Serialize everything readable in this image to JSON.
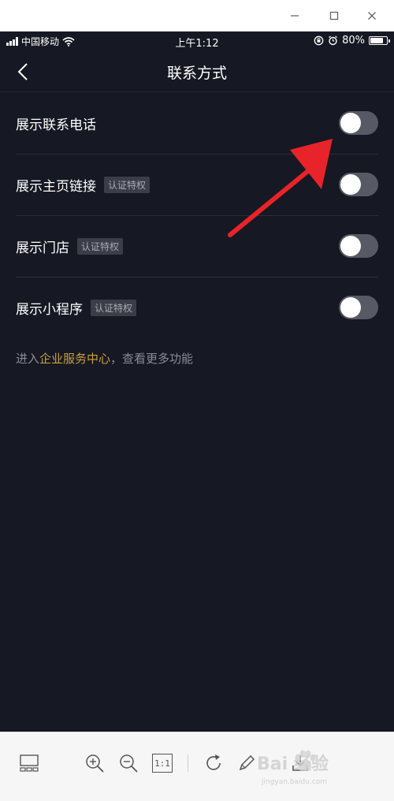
{
  "window": {
    "controls": [
      "minimize-icon",
      "maximize-icon",
      "close-icon"
    ]
  },
  "status_bar": {
    "carrier": "中国移动",
    "time": "上午1:12",
    "battery": "80%",
    "battery_level": 0.8
  },
  "nav": {
    "title": "联系方式",
    "back_icon": "chevron-left-icon"
  },
  "settings": [
    {
      "label": "展示联系电话",
      "badge": "",
      "enabled": false
    },
    {
      "label": "展示主页链接",
      "badge": "认证特权",
      "enabled": false
    },
    {
      "label": "展示门店",
      "badge": "认证特权",
      "enabled": false
    },
    {
      "label": "展示小程序",
      "badge": "认证特权",
      "enabled": false
    }
  ],
  "footer": {
    "prefix": "进入",
    "link": "企业服务中心",
    "suffix": "，查看更多功能"
  },
  "toolbar": {
    "tools": [
      "thumbnail-icon",
      "zoom-in-icon",
      "zoom-out-icon",
      "actual-size-icon",
      "rotate-icon",
      "edit-icon",
      "download-icon"
    ],
    "actual_size_label": "1:1"
  },
  "watermark": {
    "text": "Bai 经验",
    "url": "jingyan.baidu.com"
  },
  "colors": {
    "background": "#161823",
    "toggle_off": "#575a64",
    "link": "#c9a23d",
    "arrow": "#e8232a"
  }
}
